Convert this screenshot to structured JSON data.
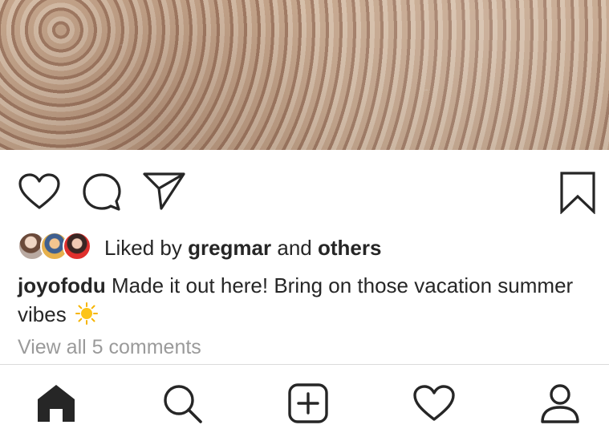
{
  "post": {
    "photo_alt_icon": "rocks-photo",
    "likes": {
      "prefix": "Liked by",
      "user": "gregmar",
      "conjunction": "and",
      "others": "others"
    },
    "caption": {
      "username": "joyofodu",
      "text": "Made it out here! Bring on those vacation summer vibes",
      "emoji_icon": "sun-icon"
    },
    "comments_link": "View all 5 comments"
  },
  "actions": {
    "icons": [
      "heart-icon",
      "comment-icon",
      "share-icon",
      "bookmark-icon"
    ]
  },
  "tabbar": {
    "tabs": [
      "home-icon",
      "search-icon",
      "add-post-icon",
      "activity-heart-icon",
      "profile-icon"
    ]
  },
  "colors": {
    "text": "#262626",
    "muted": "#9a9a9a",
    "divider": "#dbdbdb",
    "sun": "#f6b400"
  }
}
